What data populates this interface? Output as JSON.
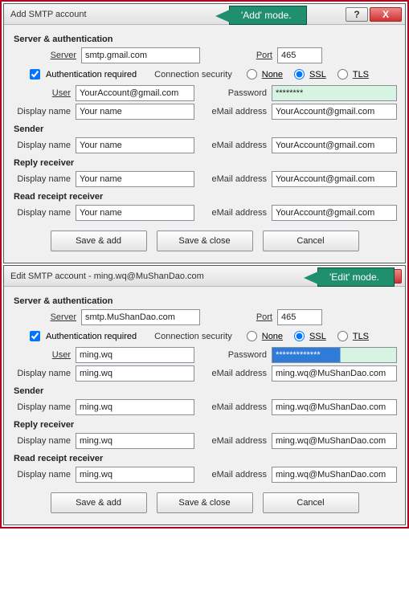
{
  "callouts": {
    "add": "'Add' mode.",
    "edit": "'Edit' mode."
  },
  "common": {
    "groups": {
      "server_auth": "Server & authentication",
      "sender": "Sender",
      "reply": "Reply receiver",
      "receipt": "Read receipt receiver"
    },
    "labels": {
      "server": "Server",
      "port": "Port",
      "auth_required": "Authentication required",
      "conn_sec": "Connection security",
      "none": "None",
      "ssl": "SSL",
      "tls": "TLS",
      "user": "User",
      "password": "Password",
      "display_name": "Display name",
      "email": "eMail address"
    },
    "buttons": {
      "save_add": "Save & add",
      "save_close": "Save & close",
      "cancel": "Cancel"
    },
    "win": {
      "help": "?",
      "close": "X"
    }
  },
  "add": {
    "title": "Add SMTP account",
    "server_auth": {
      "server": "smtp.gmail.com",
      "port": "465",
      "auth_required": true,
      "security": "SSL",
      "user": "YourAccount@gmail.com",
      "password": "********",
      "display_name": "Your name",
      "email": "YourAccount@gmail.com"
    },
    "sender": {
      "display_name": "Your name",
      "email": "YourAccount@gmail.com"
    },
    "reply": {
      "display_name": "Your name",
      "email": "YourAccount@gmail.com"
    },
    "receipt": {
      "display_name": "Your name",
      "email": "YourAccount@gmail.com"
    }
  },
  "edit": {
    "title": "Edit SMTP account - ming.wq@MuShanDao.com",
    "server_auth": {
      "server": "smtp.MuShanDao.com",
      "port": "465",
      "auth_required": true,
      "security": "SSL",
      "user": "ming.wq",
      "password": "*************",
      "display_name": "ming.wq",
      "email": "ming.wq@MuShanDao.com"
    },
    "sender": {
      "display_name": "ming.wq",
      "email": "ming.wq@MuShanDao.com"
    },
    "reply": {
      "display_name": "ming.wq",
      "email": "ming.wq@MuShanDao.com"
    },
    "receipt": {
      "display_name": "ming.wq",
      "email": "ming.wq@MuShanDao.com"
    }
  }
}
